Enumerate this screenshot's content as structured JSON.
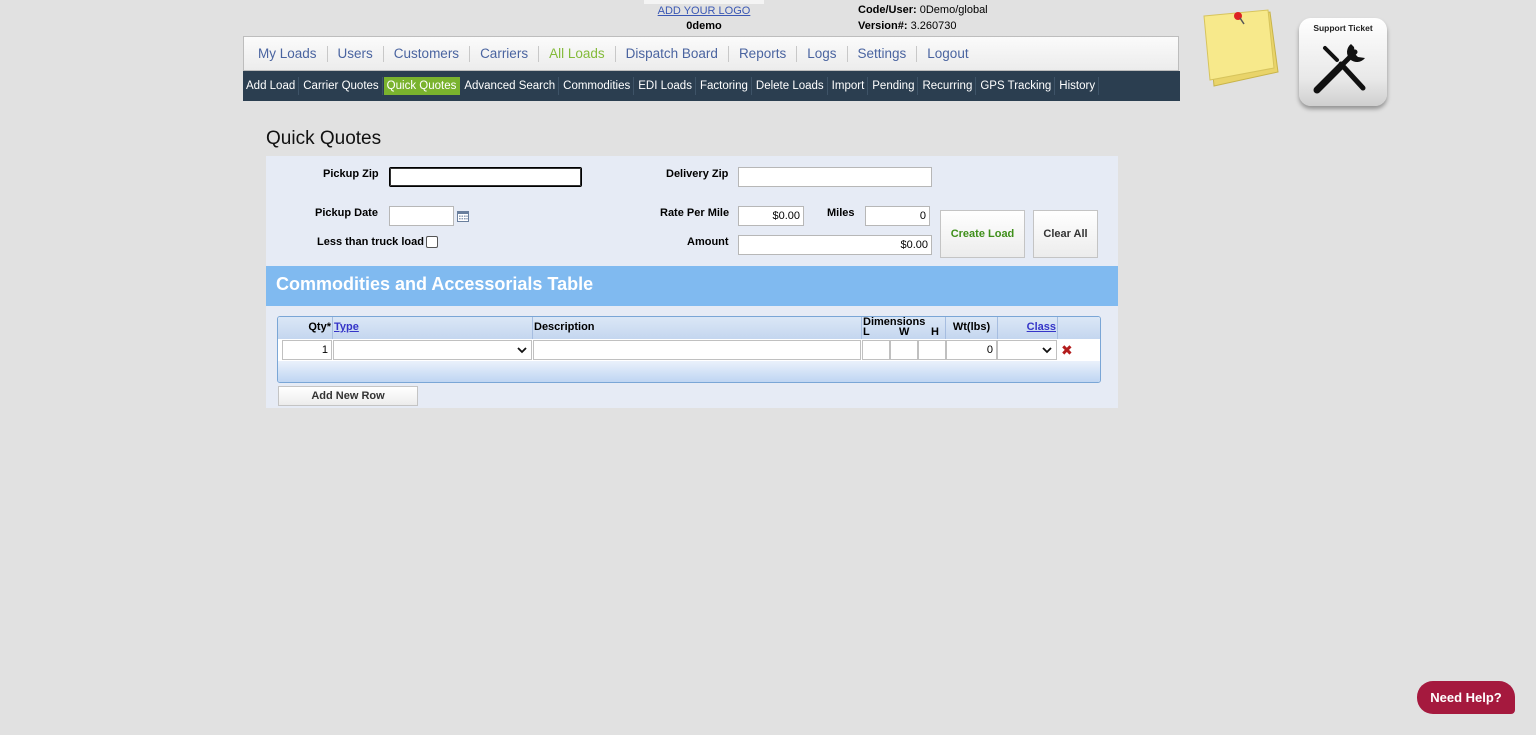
{
  "header": {
    "add_logo": "ADD YOUR LOGO",
    "company": "0demo",
    "code_user_label": "Code/User:",
    "code_user_value": "0Demo/global",
    "version_label": "Version#:",
    "version_value": "3.260730",
    "support_label": "Support Ticket"
  },
  "main_nav": [
    {
      "label": "My Loads"
    },
    {
      "label": "Users"
    },
    {
      "label": "Customers"
    },
    {
      "label": "Carriers"
    },
    {
      "label": "All Loads",
      "active": true
    },
    {
      "label": "Dispatch Board"
    },
    {
      "label": "Reports"
    },
    {
      "label": "Logs"
    },
    {
      "label": "Settings"
    },
    {
      "label": "Logout"
    }
  ],
  "sub_nav": [
    {
      "label": "Add Load"
    },
    {
      "label": "Carrier Quotes"
    },
    {
      "label": "Quick Quotes",
      "active": true
    },
    {
      "label": "Advanced Search"
    },
    {
      "label": "Commodities"
    },
    {
      "label": "EDI Loads"
    },
    {
      "label": "Factoring"
    },
    {
      "label": "Delete Loads"
    },
    {
      "label": "Import"
    },
    {
      "label": "Pending"
    },
    {
      "label": "Recurring"
    },
    {
      "label": "GPS Tracking"
    },
    {
      "label": "History"
    }
  ],
  "page_title": "Quick Quotes",
  "form": {
    "pickup_zip_label": "Pickup Zip",
    "pickup_zip_value": "",
    "delivery_zip_label": "Delivery Zip",
    "delivery_zip_value": "",
    "pickup_date_label": "Pickup Date",
    "pickup_date_value": "",
    "ltl_label": "Less than truck load",
    "ltl_checked": false,
    "rate_per_mile_label": "Rate Per Mile",
    "rate_per_mile_value": "$0.00",
    "miles_label": "Miles",
    "miles_value": "0",
    "amount_label": "Amount",
    "amount_value": "$0.00",
    "create_load": "Create Load",
    "clear_all": "Clear All"
  },
  "commodities": {
    "title": "Commodities and Accessorials Table",
    "headers": {
      "qty": "Qty*",
      "type": "Type",
      "description": "Description",
      "dimensions": "Dimensions",
      "l": "L",
      "w": "W",
      "h": "H",
      "weight": "Wt(lbs)",
      "class": "Class"
    },
    "rows": [
      {
        "qty": "1",
        "type": "",
        "description": "",
        "l": "",
        "w": "",
        "h": "",
        "weight": "0",
        "class": ""
      }
    ],
    "add_row": "Add New Row"
  },
  "help": "Need Help?",
  "colors": {
    "nav_active": "#84bb3a",
    "subnav_bg": "#2b3e50",
    "subnav_active": "#7ab32e",
    "section_head": "#80baf0",
    "help_btn": "#a5193e"
  }
}
